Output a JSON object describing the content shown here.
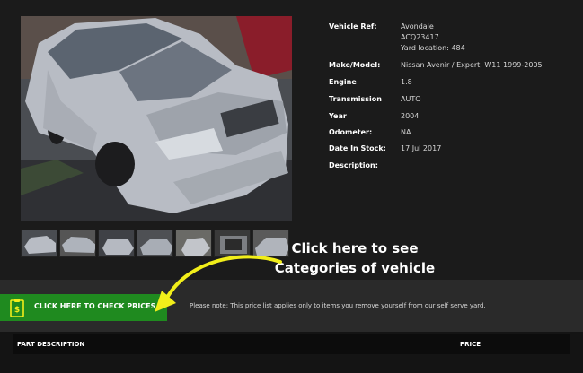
{
  "vehicle": {
    "rows": [
      {
        "key": "Vehicle Ref:",
        "lines": [
          "Avondale",
          "ACQ23417",
          "Yard location: 484"
        ]
      },
      {
        "key": "Make/Model:",
        "lines": [
          "Nissan Avenir / Expert, W11 1999-2005"
        ]
      },
      {
        "key": "Engine",
        "lines": [
          "1.8"
        ]
      },
      {
        "key": "Transmission",
        "lines": [
          "AUTO"
        ]
      },
      {
        "key": "Year",
        "lines": [
          "2004"
        ]
      },
      {
        "key": "Odometer:",
        "lines": [
          "NA"
        ]
      },
      {
        "key": "Date In Stock:",
        "lines": [
          "17 Jul 2017"
        ]
      },
      {
        "key": "Description:",
        "lines": [
          ""
        ]
      }
    ]
  },
  "annotation": {
    "line1": "Click here to see",
    "line2": "Categories of vehicle"
  },
  "price": {
    "button_label": "CLICK HERE TO CHECK PRICES",
    "note": "Please note: This price list applies only to items you remove yourself from our self serve yard.",
    "columns": [
      "PART DESCRIPTION",
      "PRICE"
    ]
  },
  "colors": {
    "button_green": "#1f8a1f",
    "arrow_yellow": "#f2ee1a",
    "background": "#1b1b1b"
  }
}
